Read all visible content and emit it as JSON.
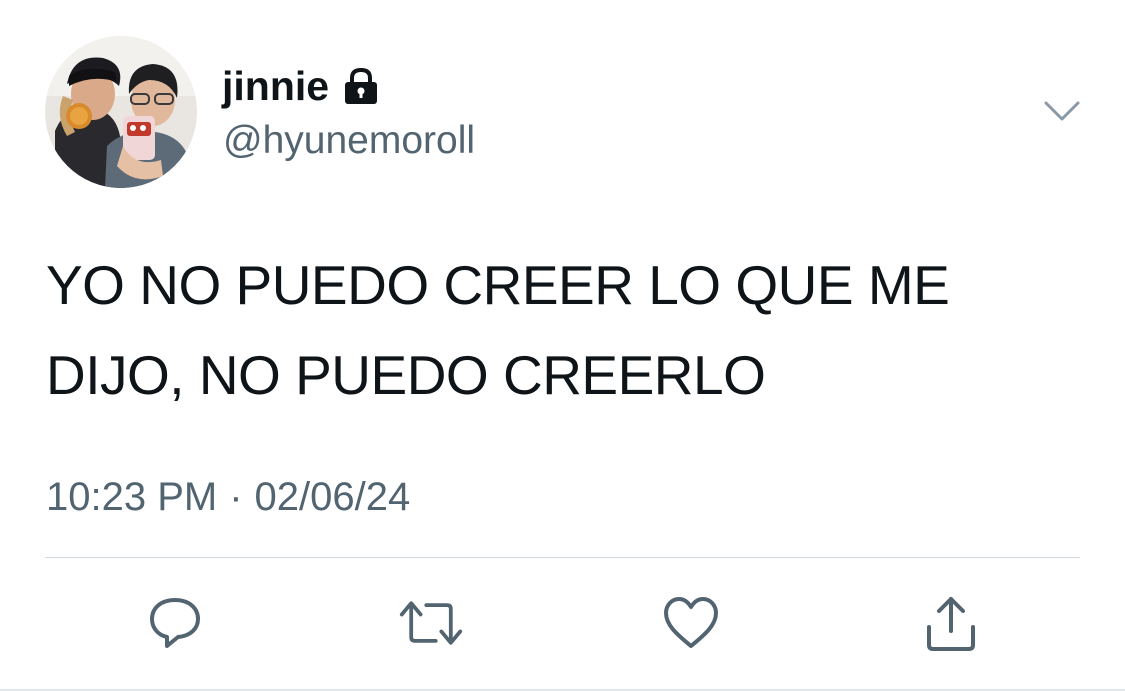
{
  "author": {
    "display_name": "jinnie",
    "handle": "@hyunemoroll",
    "protected_icon": "lock-icon",
    "avatar": "profile-photo"
  },
  "tweet": {
    "text": "YO NO PUEDO CREER LO QUE ME DIJO, NO PUEDO CREERLO",
    "time": "10:23 PM",
    "separator": "·",
    "date": "02/06/24"
  },
  "actions": [
    {
      "name": "reply",
      "icon": "reply-icon"
    },
    {
      "name": "retweet",
      "icon": "retweet-icon"
    },
    {
      "name": "like",
      "icon": "heart-icon"
    },
    {
      "name": "share",
      "icon": "share-icon"
    }
  ],
  "colors": {
    "text_primary": "#0f1419",
    "text_secondary": "#536471",
    "icon_gray": "#536471",
    "divider": "#cfd9de"
  }
}
